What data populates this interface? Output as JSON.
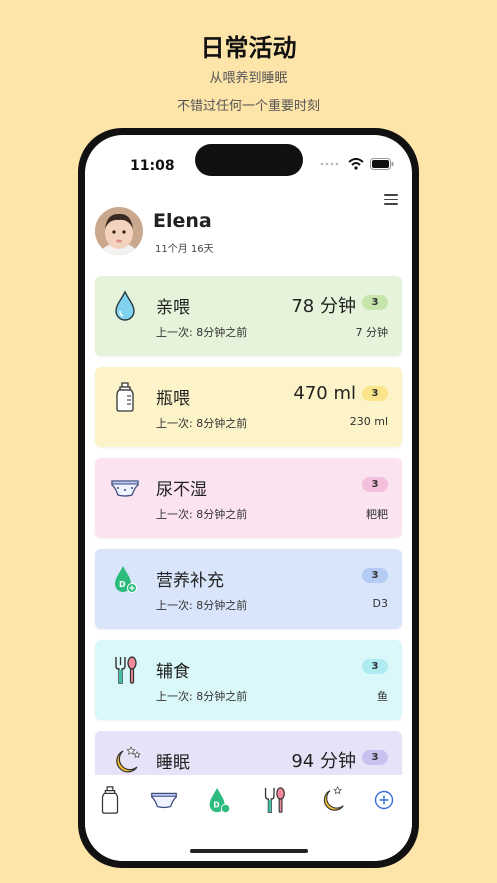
{
  "promo": {
    "title": "日常活动",
    "line1": "从喂养到睡眠",
    "line2": "不错过任何一个重要时刻"
  },
  "status_bar": {
    "time": "11:08"
  },
  "profile": {
    "name": "Elena",
    "age": "11个月 16天"
  },
  "cards": [
    {
      "title": "亲喂",
      "value": "78 分钟",
      "badge": "3",
      "last": "上一次: 8分钟之前",
      "detail": "7 分钟",
      "bg": "#e4f3d9",
      "badge_bg": "#c6e5ad",
      "icon": "water-drop-icon"
    },
    {
      "title": "瓶喂",
      "value": "470 ml",
      "badge": "3",
      "last": "上一次: 8分钟之前",
      "detail": "230 ml",
      "bg": "#fdf3c8",
      "badge_bg": "#fbe58a",
      "icon": "baby-bottle-icon"
    },
    {
      "title": "尿不湿",
      "value": "",
      "badge": "3",
      "last": "上一次: 8分钟之前",
      "detail": "粑粑",
      "bg": "#fbe4f0",
      "badge_bg": "#f4bfdc",
      "icon": "diaper-icon"
    },
    {
      "title": "营养补充",
      "value": "",
      "badge": "3",
      "last": "上一次: 8分钟之前",
      "detail": "D3",
      "bg": "#d9e5fb",
      "badge_bg": "#b4cbf4",
      "icon": "vitamin-d-icon"
    },
    {
      "title": "辅食",
      "value": "",
      "badge": "3",
      "last": "上一次: 8分钟之前",
      "detail": "鱼",
      "bg": "#daf7f9",
      "badge_bg": "#aeecf1",
      "icon": "utensils-icon"
    },
    {
      "title": "睡眠",
      "value": "94 分钟",
      "badge": "3",
      "last": "",
      "detail": "",
      "bg": "#e7e2f8",
      "badge_bg": "#cbc1f0",
      "icon": "moon-stars-icon"
    }
  ],
  "tabbar": [
    "baby-bottle-icon",
    "diaper-icon",
    "vitamin-d-icon",
    "utensils-icon",
    "moon-stars-icon",
    "add-circle-icon"
  ]
}
